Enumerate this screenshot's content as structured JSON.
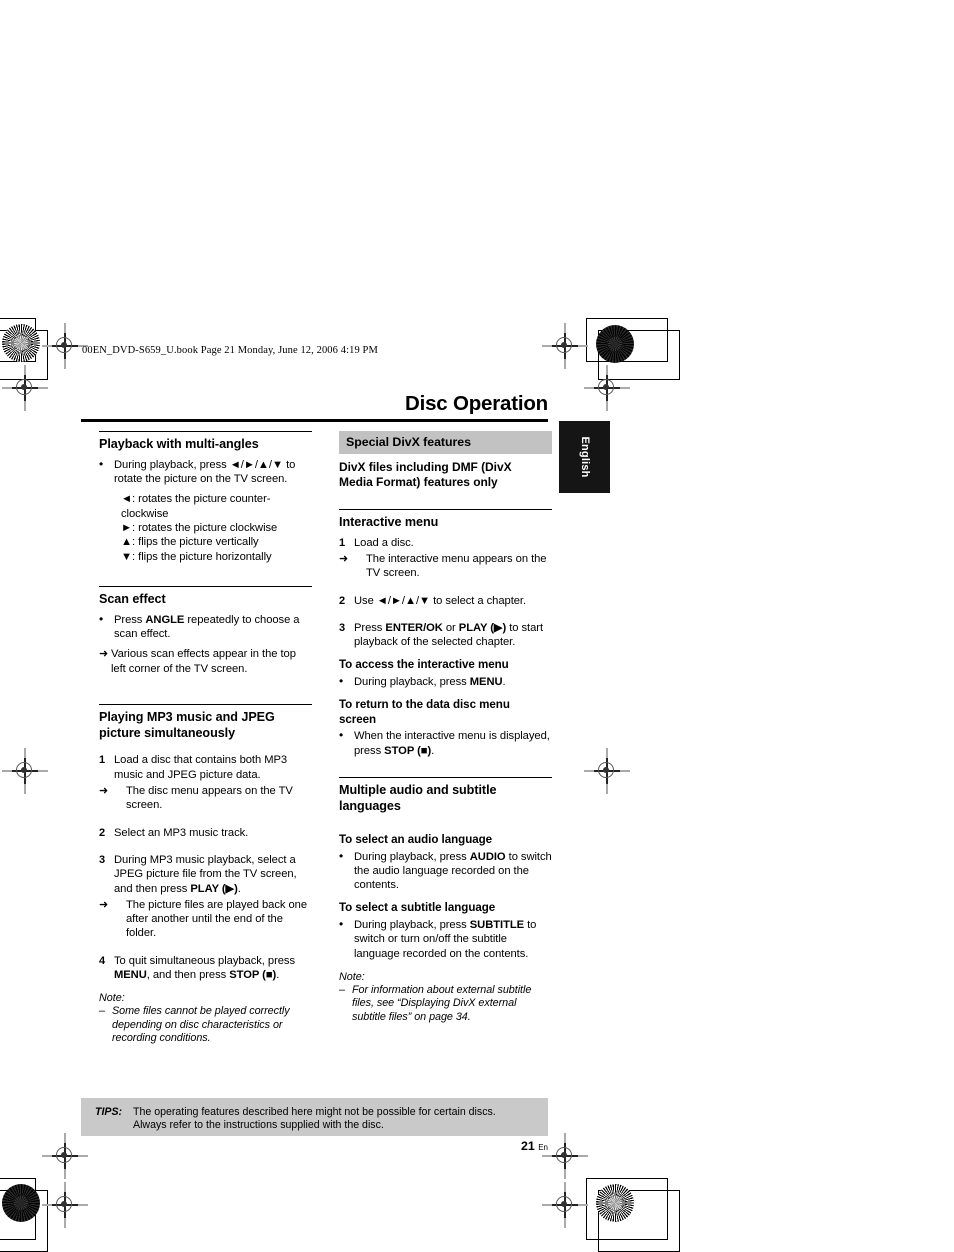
{
  "page": {
    "file_stamp": "00EN_DVD-S659_U.book  Page 21  Monday, June 12, 2006  4:19 PM",
    "chapter_title": "Disc Operation",
    "language_tab": "English",
    "page_number": "21",
    "page_number_suffix": "En",
    "gray_bar_color": "#c2c2c2",
    "tips_box_color": "#c9c9c9"
  },
  "left_column": {
    "section1": {
      "heading": "Playback with multi-angles",
      "bullet": "During playback, press ◄/►/▲/▼ to rotate the picture on the TV screen.",
      "glyph_lines": [
        "◄: rotates the picture counter-clockwise",
        "►: rotates the picture clockwise",
        "▲: flips the picture vertically",
        "▼: flips the picture horizontally"
      ]
    },
    "section2": {
      "heading": "Scan effect",
      "bullet_pre": "Press ",
      "bullet_bold": "ANGLE",
      "bullet_post": " repeatedly to choose a scan effect.",
      "arrow": "Various scan effects appear in the top left corner of the TV screen."
    },
    "section3": {
      "heading_line1": "Playing MP3 music and JPEG",
      "heading_line2": "picture simultaneously",
      "steps": [
        {
          "num": "1",
          "text": "Load a disc that contains both MP3 music and JPEG picture data.",
          "arrow": "The disc menu appears on the TV screen."
        },
        {
          "num": "2",
          "text": "Select an MP3 music track."
        },
        {
          "num": "3",
          "text_pre": "During MP3 music playback, select a JPEG picture file from the TV screen, and then press ",
          "text_bold": "PLAY (▶)",
          "text_post": ".",
          "arrow": "The picture files are played back one after another until the end of the folder."
        },
        {
          "num": "4",
          "text_pre": "To quit simultaneous playback, press ",
          "text_bold1": "MENU",
          "text_mid": ", and then press ",
          "text_bold2": "STOP (■)",
          "text_post": "."
        }
      ],
      "note_label": "Note:",
      "note_items": [
        "Some files cannot be played correctly depending on disc characteristics or recording conditions."
      ]
    }
  },
  "right_column": {
    "section1": {
      "gray_bar": "Special DivX features",
      "bold_lead_line1": "DivX files including DMF (DivX",
      "bold_lead_line2": "Media Format) features only"
    },
    "section2": {
      "heading": "Interactive menu",
      "steps": [
        {
          "num": "1",
          "text": "Load a disc.",
          "arrow": "The interactive menu appears on the TV screen."
        },
        {
          "num": "2",
          "text": "Use ◄/►/▲/▼ to select a chapter."
        },
        {
          "num": "3",
          "text_pre": "Press ",
          "text_bold1": "ENTER/OK",
          "text_mid": " or ",
          "text_bold2": "PLAY (▶)",
          "text_post": " to start playback of the selected chapter."
        }
      ],
      "sub1": {
        "heading": "To access the interactive menu",
        "bullet_pre": "During playback, press ",
        "bullet_bold": "MENU",
        "bullet_post": "."
      },
      "sub2": {
        "heading_line1": "To return to the data disc menu",
        "heading_line2": "screen",
        "bullet_pre": "When the interactive menu is displayed, press ",
        "bullet_bold": "STOP (■)",
        "bullet_post": "."
      }
    },
    "section3": {
      "heading_line1": "Multiple audio and subtitle",
      "heading_line2": "languages",
      "sub1": {
        "heading": "To select an audio language",
        "bullet_pre": "During playback, press ",
        "bullet_bold": "AUDIO",
        "bullet_post": " to switch the audio language recorded on the contents."
      },
      "sub2": {
        "heading": "To select a subtitle language",
        "bullet_pre": "During playback, press ",
        "bullet_bold": "SUBTITLE",
        "bullet_post": " to switch or turn on/off the subtitle language recorded on the contents."
      },
      "note_label": "Note:",
      "note_items": [
        "For information about external subtitle files, see “Displaying DivX external subtitle files” on page 34."
      ]
    }
  },
  "tips": {
    "label": "TIPS:",
    "line1": "The operating features described here might not be possible for certain discs.",
    "line2": "Always refer to the instructions supplied with the disc."
  },
  "markers": {
    "bullet": "•",
    "arrow": "➜",
    "dash": "–"
  }
}
